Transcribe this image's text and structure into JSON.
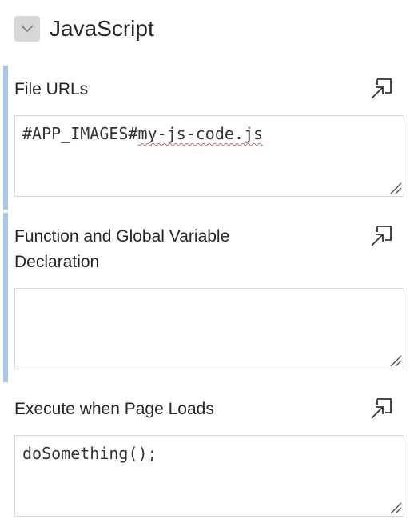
{
  "region": {
    "title": "JavaScript",
    "toggle_icon": "chevron-down-icon"
  },
  "fields": {
    "file_urls": {
      "label": "File URLs",
      "value_prefix": "#APP_IMAGES#",
      "value_flagged": "my-js-code.js",
      "expand_icon": "expand-icon"
    },
    "function_declaration": {
      "label_line1": "Function and Global Variable",
      "label_line2": "Declaration",
      "value": "",
      "expand_icon": "expand-icon"
    },
    "page_load": {
      "label": "Execute when Page Loads",
      "value": "doSomething();",
      "expand_icon": "expand-icon"
    }
  },
  "colors": {
    "modified_bar": "#a9c7e8",
    "toggle_bg": "#d7d7d7",
    "spellcheck": "#e06060"
  }
}
